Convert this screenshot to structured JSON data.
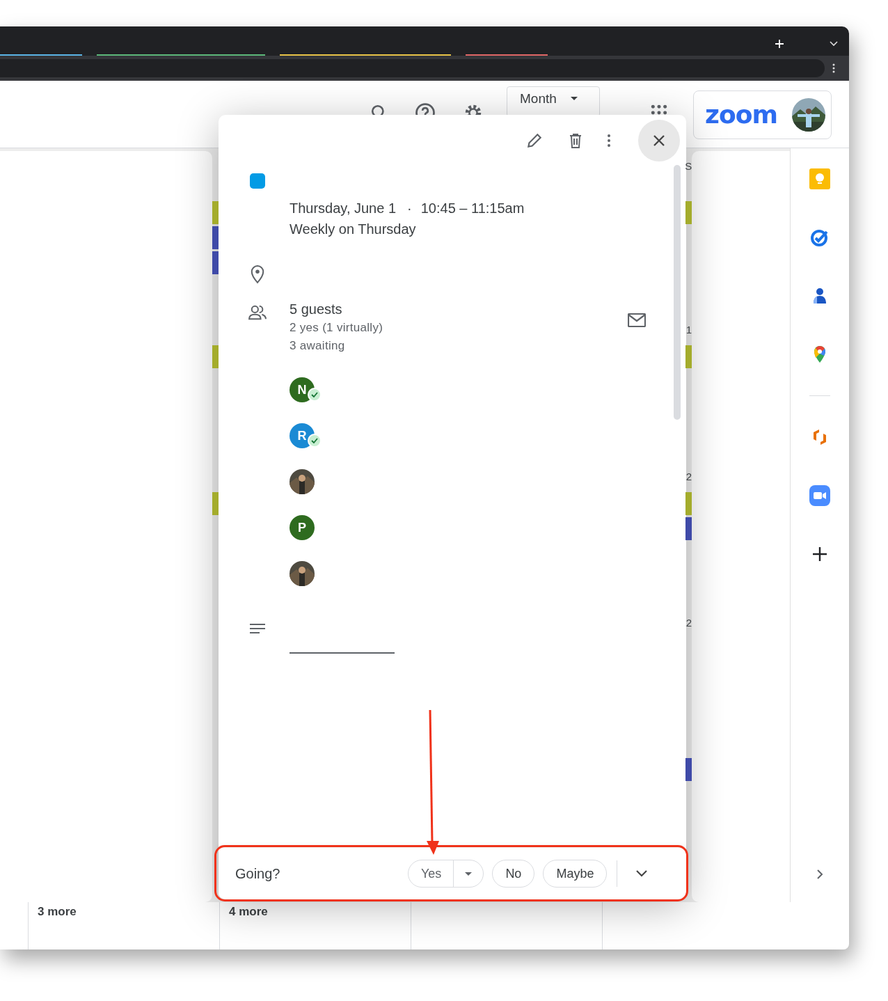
{
  "browser": {
    "tabs": [
      {
        "color": "#5ab4e6"
      },
      {
        "color": "#5cb87a"
      },
      {
        "color": "#e8c247"
      },
      {
        "color": "#e06666"
      }
    ]
  },
  "calendar": {
    "view_button": "Month",
    "zoom_logo": "zoom",
    "weeks": [
      {
        "label": "S",
        "left_chips": [
          {
            "color": "#a4ac2c"
          },
          {
            "color": "#3f4aa8"
          },
          {
            "color": "#3f4aa8"
          }
        ],
        "right_chips": [
          {
            "color": "#a4ac2c"
          }
        ]
      },
      {
        "label": "1",
        "left_chips": [
          {
            "color": "#a4ac2c"
          }
        ],
        "right_chips": [
          {
            "color": "#a4ac2c"
          }
        ]
      },
      {
        "label": "2",
        "left_chips": [
          {
            "color": "#a4ac2c"
          }
        ],
        "right_chips": [
          {
            "color": "#a4ac2c"
          },
          {
            "color": "#3f4aa8"
          }
        ]
      },
      {
        "label": "2"
      },
      {
        "right_chips": [
          {
            "color": "#3f4aa8"
          }
        ]
      }
    ],
    "more_links": [
      "3 more",
      "4 more"
    ]
  },
  "event": {
    "color": "#039be5",
    "date": "Thursday, June 1",
    "separator": "·",
    "time": "10:45 – 11:15am",
    "recurrence": "Weekly on Thursday",
    "guests_summary": "5 guests",
    "guests_yes": "2 yes (1 virtually)",
    "guests_awaiting": "3 awaiting",
    "guests": [
      {
        "kind": "initial",
        "initial": "N",
        "color": "#2e6b1f",
        "accepted": true
      },
      {
        "kind": "initial",
        "initial": "R",
        "color": "#1a8ad4",
        "accepted": true
      },
      {
        "kind": "picture",
        "accepted": false
      },
      {
        "kind": "initial",
        "initial": "P",
        "color": "#2e6b1f",
        "accepted": false
      },
      {
        "kind": "picture",
        "accepted": false
      }
    ]
  },
  "rsvp": {
    "prompt": "Going?",
    "options": [
      {
        "label": "Yes",
        "selected": false,
        "has_menu": true
      },
      {
        "label": "No",
        "selected": false,
        "has_menu": false
      },
      {
        "label": "Maybe",
        "selected": false,
        "has_menu": false
      }
    ]
  }
}
